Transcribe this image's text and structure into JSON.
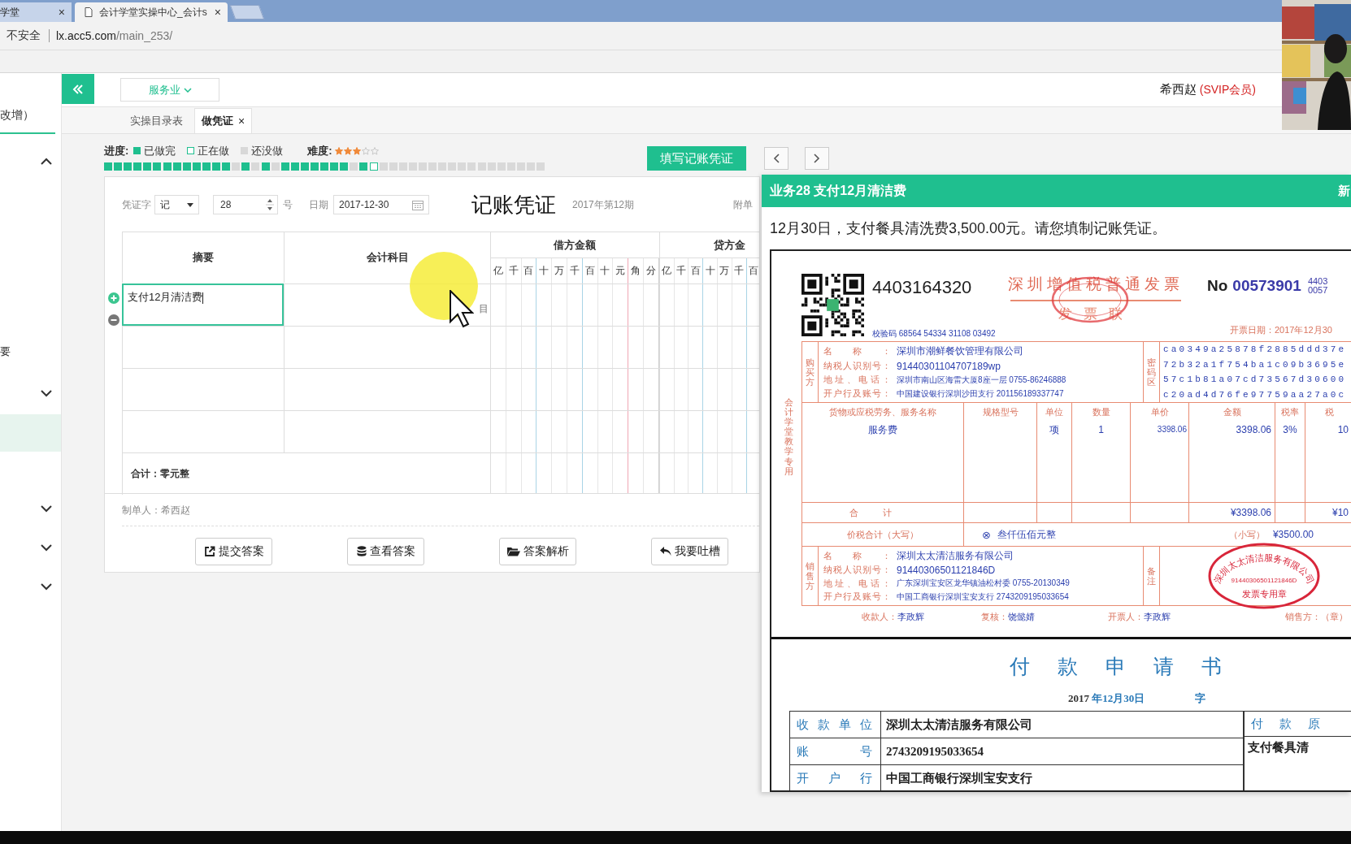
{
  "browser": {
    "tabs": [
      {
        "title": "学堂",
        "close": "×",
        "selected": false
      },
      {
        "title": "会计学堂实操中心_会计s",
        "close": "×",
        "selected": true
      }
    ],
    "security": "不安全",
    "url_host": "lx.acc5.com",
    "url_path": "/main_253/"
  },
  "sidebar": {
    "title": "改增）",
    "rows": [
      {
        "kind": "section",
        "expanded": true
      },
      {
        "kind": "item",
        "label": "要",
        "selected": false
      },
      {
        "kind": "section",
        "expanded": false
      },
      {
        "kind": "item",
        "selected": true
      },
      {
        "kind": "section",
        "expanded": false
      },
      {
        "kind": "section",
        "expanded": false
      },
      {
        "kind": "section",
        "expanded": false
      }
    ]
  },
  "header": {
    "industry": "服务业",
    "user_name": "希西赵",
    "user_badge": "(SVIP会员)"
  },
  "tabs": [
    {
      "label": "实操目录表",
      "selected": false
    },
    {
      "label": "做凭证",
      "close": "×",
      "selected": true
    }
  ],
  "progress": {
    "label": "进度:",
    "legend": [
      {
        "kind": "done",
        "label": "已做完"
      },
      {
        "kind": "doing",
        "label": "正在做"
      },
      {
        "kind": "todo",
        "label": "还没做"
      }
    ],
    "difficulty_label": "难度:",
    "stars": 3,
    "steps": [
      {
        "done": true,
        "current": false
      },
      {
        "done": true,
        "current": false
      },
      {
        "done": true,
        "current": false
      },
      {
        "done": true,
        "current": false
      },
      {
        "done": true,
        "current": false
      },
      {
        "done": true,
        "current": false
      },
      {
        "done": true,
        "current": false
      },
      {
        "done": true,
        "current": false
      },
      {
        "done": true,
        "current": false
      },
      {
        "done": true,
        "current": false
      },
      {
        "done": true,
        "current": false
      },
      {
        "done": true,
        "current": false
      },
      {
        "done": true,
        "current": false
      },
      {
        "done": false,
        "current": false
      },
      {
        "done": true,
        "current": false
      },
      {
        "done": false,
        "current": false
      },
      {
        "done": true,
        "current": false
      },
      {
        "done": false,
        "current": false
      },
      {
        "done": true,
        "current": false
      },
      {
        "done": true,
        "current": false
      },
      {
        "done": true,
        "current": false
      },
      {
        "done": true,
        "current": false
      },
      {
        "done": true,
        "current": false
      },
      {
        "done": true,
        "current": false
      },
      {
        "done": true,
        "current": false
      },
      {
        "done": false,
        "current": false
      },
      {
        "done": true,
        "current": false
      },
      {
        "done": false,
        "current": true
      },
      {
        "done": false,
        "current": false
      },
      {
        "done": false,
        "current": false
      },
      {
        "done": false,
        "current": false
      },
      {
        "done": false,
        "current": false
      },
      {
        "done": false,
        "current": false
      },
      {
        "done": false,
        "current": false
      },
      {
        "done": false,
        "current": false
      },
      {
        "done": false,
        "current": false
      },
      {
        "done": false,
        "current": false
      },
      {
        "done": false,
        "current": false
      },
      {
        "done": false,
        "current": false
      },
      {
        "done": false,
        "current": false
      },
      {
        "done": false,
        "current": false
      },
      {
        "done": false,
        "current": false
      },
      {
        "done": false,
        "current": false
      },
      {
        "done": false,
        "current": false
      },
      {
        "done": false,
        "current": false
      }
    ]
  },
  "fill_button": "填写记账凭证",
  "voucher": {
    "word_label": "凭证字",
    "word": "记",
    "number": "28",
    "number_suffix": "号",
    "date_label": "日期",
    "date": "2017-12-30",
    "title": "记账凭证",
    "period": "2017年第12期",
    "attachments_label": "附单",
    "columns": {
      "summary": "摘要",
      "account": "会计科目",
      "debit": "借方金额",
      "credit": "贷方金"
    },
    "debit_digits": [
      "亿",
      "千",
      "百",
      "十",
      "万",
      "千",
      "百",
      "十",
      "元",
      "角",
      "分"
    ],
    "credit_digits": [
      "亿",
      "千",
      "百",
      "十",
      "万",
      "千",
      "百"
    ],
    "rows": [
      {
        "summary": "支付12月清洁费",
        "account_hint": "目",
        "focused": true
      },
      {
        "focused": false
      },
      {
        "focused": false
      },
      {
        "focused": false
      }
    ],
    "total": "合计：零元整",
    "maker": "制单人：希西赵"
  },
  "actions": [
    {
      "kind": "submit",
      "label": "提交答案"
    },
    {
      "kind": "answer",
      "label": "查看答案"
    },
    {
      "kind": "analysis",
      "label": "答案解析"
    },
    {
      "kind": "feedback",
      "label": "我要吐槽"
    }
  ],
  "task": {
    "title": "业务28 支付12月清洁费",
    "header_right": "新",
    "description": "12月30日，支付餐具清洗费3,500.00元。请您填制记账凭证。",
    "invoice": {
      "code": "4403164320",
      "title": "深圳增值税普通发票",
      "copy": "发票联",
      "no_label": "No",
      "number": "00573901",
      "code_small": [
        "4403",
        "0057"
      ],
      "check_code": "校验码 68564 54334 31108 03492",
      "date": "开票日期：2017年12月30",
      "side_label": "会计学堂教学专用",
      "buyer": {
        "label": "购买方",
        "fields": [
          {
            "label": "名称：",
            "value": "深圳市潮鲜餐饮管理有限公司"
          },
          {
            "label": "纳税人识别号：",
            "value": "91440301104707189wp"
          },
          {
            "label": "地址、电话：",
            "value": "深圳市南山区海雷大厦8座一层 0755-86246888"
          },
          {
            "label": "开户行及账号：",
            "value": "中国建设银行深圳沙田支行 201156189337747"
          }
        ],
        "cipher_label": "密码区",
        "cipher": [
          "ca0349a25878f2885ddd37e",
          "72b32a1f754ba1c09b3695e",
          "57c1b81a07cd73567d30600",
          "c20ad4d76fe97759aa27a0c"
        ]
      },
      "items_header": [
        "货物或应税劳务、服务名称",
        "规格型号",
        "单位",
        "数量",
        "单价",
        "金额",
        "税率",
        "税"
      ],
      "items": [
        {
          "name": "服务费",
          "unit": "项",
          "qty": "1",
          "price": "3398.06",
          "amount": "3398.06",
          "rate": "3%",
          "tax": "10"
        }
      ],
      "total_label": "合计",
      "total_amount": "¥3398.06",
      "total_tax": "¥10",
      "grand_label": "价税合计（大写）",
      "grand_mark": "⊗",
      "grand_words": "叁仟伍佰元整",
      "grand_small_label": "（小写）",
      "grand_amount": "¥3500.00",
      "seller": {
        "label": "销售方",
        "fields": [
          {
            "label": "名称：",
            "value": "深圳太太清洁服务有限公司"
          },
          {
            "label": "纳税人识别号：",
            "value": "91440306501121846D"
          },
          {
            "label": "地址、电话：",
            "value": "广东深圳宝安区龙华镇油松村委 0755-20130349"
          },
          {
            "label": "开户行及账号：",
            "value": "中国工商银行深圳宝安支行 2743209195033654"
          }
        ],
        "remark_label": "备注",
        "stamp_name": "深圳太太清洁服务有限公司",
        "stamp_number": "91440306501121846D",
        "stamp_title": "发票专用章"
      },
      "footer": [
        {
          "label": "收款人：",
          "value": "李政辉"
        },
        {
          "label": "复核：",
          "value": "饶懿婧"
        },
        {
          "label": "开票人：",
          "value": "李政辉"
        },
        {
          "label": "销售方：（章）"
        }
      ]
    },
    "payment_request": {
      "title": "付款申请书",
      "date_year": "2017",
      "date_rest": "年12月30日",
      "date_word": "字",
      "rows": [
        {
          "label": "收款单位",
          "value": "深圳太太清洁服务有限公司"
        },
        {
          "label": "账号",
          "value": "2743209195033654"
        },
        {
          "label": "开户行",
          "value": "中国工商银行深圳宝安支行"
        }
      ],
      "side_header": "付款原",
      "side_value": "支付餐具清"
    }
  }
}
